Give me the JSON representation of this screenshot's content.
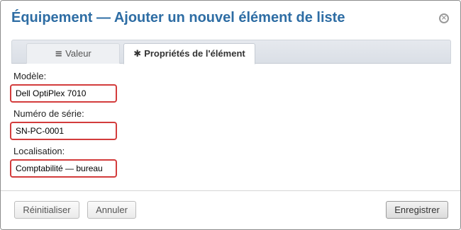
{
  "dialog": {
    "title": "Équipement — Ajouter un nouvel élément de liste",
    "close_icon": "close-circle-icon"
  },
  "tabs": [
    {
      "label": "Valeur",
      "icon": "list-icon",
      "glyph": "≡",
      "active": false
    },
    {
      "label": "Propriétés de l'élément",
      "icon": "asterisk-icon",
      "glyph": "✱",
      "active": true
    }
  ],
  "fields": {
    "model": {
      "label": "Modèle:",
      "value": "Dell OptiPlex 7010"
    },
    "serial": {
      "label": "Numéro de série:",
      "value": "SN-PC-0001"
    },
    "location": {
      "label": "Localisation:",
      "value": "Comptabilité — bureau"
    }
  },
  "buttons": {
    "reset": "Réinitialiser",
    "cancel": "Annuler",
    "save": "Enregistrer"
  },
  "colors": {
    "title": "#2e6da4",
    "field_border": "#d33c3c"
  }
}
